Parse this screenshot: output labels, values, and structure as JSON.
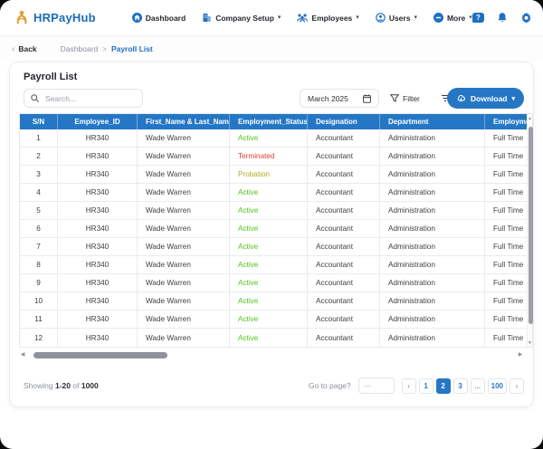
{
  "brand": {
    "name": "HRPayHub",
    "logo_icon": "person-figure-icon",
    "logo_color": "#e2a33c",
    "brand_color": "#1b6cb5"
  },
  "icons": {
    "question": "?",
    "caret_down": "▾",
    "back_chevron": "‹",
    "breadcrumb_sep": ">",
    "scroll_up": "▲",
    "scroll_down": "▼",
    "scroll_left": "◀",
    "scroll_right": "▶"
  },
  "nav": {
    "items": [
      {
        "label": "Dashboard",
        "icon": "home-icon",
        "has_caret": false
      },
      {
        "label": "Company Setup",
        "icon": "building-icon",
        "has_caret": true
      },
      {
        "label": "Employees",
        "icon": "people-group-icon",
        "has_caret": true
      },
      {
        "label": "Users",
        "icon": "user-circle-icon",
        "has_caret": true
      },
      {
        "label": "More",
        "icon": "more-circle-icon",
        "has_caret": true
      }
    ],
    "right_icons": [
      "help-icon",
      "bell-icon",
      "gear-icon",
      "avatar"
    ]
  },
  "breadcrumb": {
    "back_label": "Back",
    "path_dim": "Dashboard",
    "path_active": "Payroll List"
  },
  "page": {
    "title": "Payroll List"
  },
  "toolbar": {
    "search_placeholder": "Search...",
    "month_value": "March 2025",
    "filter_label": "Filter",
    "sort_label": "Sort",
    "download_label": "Download"
  },
  "table": {
    "columns": [
      "S/N",
      "Employee_ID",
      "First_Name & Last_Name",
      "Employment_Status",
      "Designation",
      "Department",
      "Employment_Type"
    ],
    "status_colors": {
      "Active": "#52c41a",
      "Terminated": "#e5383b",
      "Probation": "#aeae20"
    },
    "header_bg": "#2577c5",
    "rows": [
      {
        "sn": "1",
        "employee_id": "HR340",
        "name": "Wade Warren",
        "status": "Active",
        "designation": "Accountant",
        "department": "Administration",
        "type": "Full Time"
      },
      {
        "sn": "2",
        "employee_id": "HR340",
        "name": "Wade Warren",
        "status": "Terminated",
        "designation": "Accountant",
        "department": "Administration",
        "type": "Full Time"
      },
      {
        "sn": "3",
        "employee_id": "HR340",
        "name": "Wade Warren",
        "status": "Probation",
        "designation": "Accountant",
        "department": "Administration",
        "type": "Full Time"
      },
      {
        "sn": "4",
        "employee_id": "HR340",
        "name": "Wade Warren",
        "status": "Active",
        "designation": "Accountant",
        "department": "Administration",
        "type": "Full Time"
      },
      {
        "sn": "5",
        "employee_id": "HR340",
        "name": "Wade Warren",
        "status": "Active",
        "designation": "Accountant",
        "department": "Administration",
        "type": "Full Time"
      },
      {
        "sn": "6",
        "employee_id": "HR340",
        "name": "Wade Warren",
        "status": "Active",
        "designation": "Accountant",
        "department": "Administration",
        "type": "Full Time"
      },
      {
        "sn": "7",
        "employee_id": "HR340",
        "name": "Wade Warren",
        "status": "Active",
        "designation": "Accountant",
        "department": "Administration",
        "type": "Full Time"
      },
      {
        "sn": "8",
        "employee_id": "HR340",
        "name": "Wade Warren",
        "status": "Active",
        "designation": "Accountant",
        "department": "Administration",
        "type": "Full Time"
      },
      {
        "sn": "9",
        "employee_id": "HR340",
        "name": "Wade Warren",
        "status": "Active",
        "designation": "Accountant",
        "department": "Administration",
        "type": "Full Time"
      },
      {
        "sn": "10",
        "employee_id": "HR340",
        "name": "Wade Warren",
        "status": "Active",
        "designation": "Accountant",
        "department": "Administration",
        "type": "Full Time"
      },
      {
        "sn": "11",
        "employee_id": "HR340",
        "name": "Wade Warren",
        "status": "Active",
        "designation": "Accountant",
        "department": "Administration",
        "type": "Full Time"
      },
      {
        "sn": "12",
        "employee_id": "HR340",
        "name": "Wade Warren",
        "status": "Active",
        "designation": "Accountant",
        "department": "Administration",
        "type": "Full Time"
      }
    ]
  },
  "footer": {
    "showing_prefix": "Showing",
    "range": "1-20",
    "of_word": "of",
    "total": "1000",
    "goto_label": "Go to page?",
    "goto_placeholder": "—",
    "pages": [
      {
        "label": "‹",
        "type": "arrow"
      },
      {
        "label": "1"
      },
      {
        "label": "2",
        "active": true
      },
      {
        "label": "3"
      },
      {
        "label": "...",
        "type": "ellipsis"
      },
      {
        "label": "100"
      },
      {
        "label": "›",
        "type": "arrow"
      }
    ]
  }
}
